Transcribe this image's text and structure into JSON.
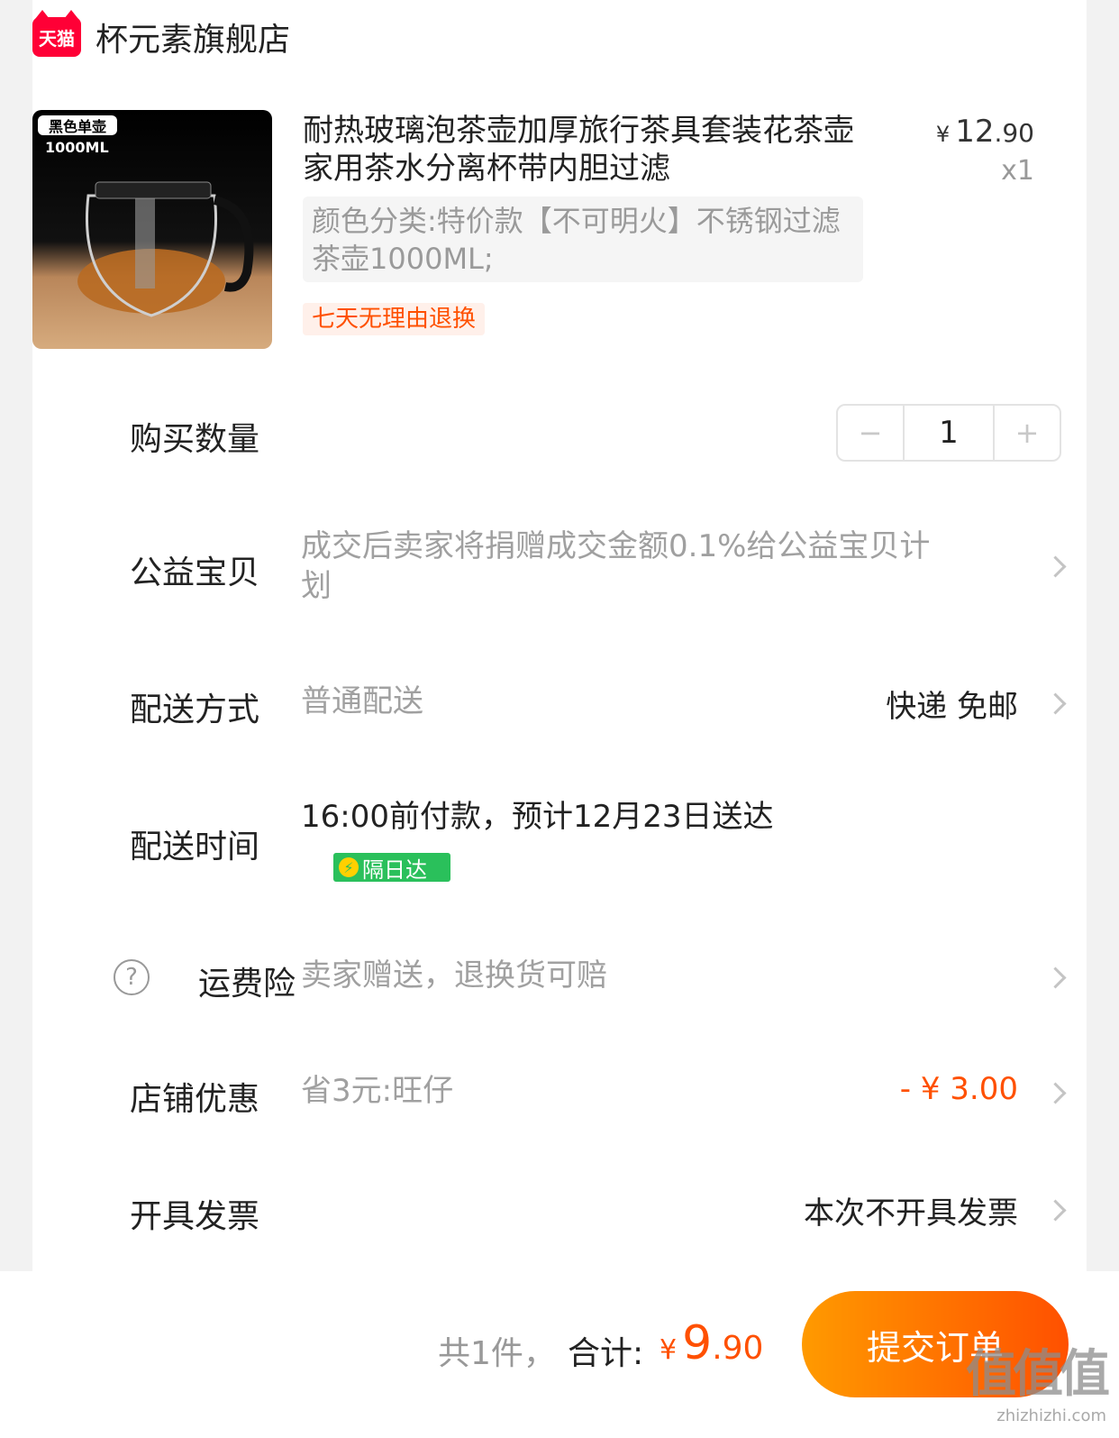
{
  "shop": {
    "logo_text": "天猫",
    "name": "杯元素旗舰店"
  },
  "product": {
    "image_badge": "黑色单壶",
    "image_size_text": "1000ML",
    "title": "耐热玻璃泡茶壶加厚旅行茶具套装花茶壶家用茶水分离杯带内胆过滤",
    "price_currency": "¥",
    "price_int": "12",
    "price_dec": ".90",
    "quantity_text": "x1",
    "sku_text": "颜色分类:特价款【不可明火】不锈钢过滤茶壶1000ML;",
    "return_tag": "七天无理由退换"
  },
  "quantity": {
    "label": "购买数量",
    "minus": "−",
    "value": "1",
    "plus": "+"
  },
  "charity": {
    "label": "公益宝贝",
    "value": "成交后卖家将捐赠成交金额0.1%给公益宝贝计划"
  },
  "delivery_method": {
    "label": "配送方式",
    "value": "普通配送",
    "right": "快递 免邮"
  },
  "delivery_time": {
    "label": "配送时间",
    "value": "16:00前付款，预计12月23日送达",
    "tag": "隔日达"
  },
  "shipping_insurance": {
    "label": "运费险",
    "value": "卖家赠送，退换货可赔"
  },
  "store_discount": {
    "label": "店铺优惠",
    "value": "省3元:旺仔",
    "amount": "- ¥ 3.00"
  },
  "invoice": {
    "label": "开具发票",
    "value": "本次不开具发票"
  },
  "footer": {
    "count_text": "共1件，",
    "total_label": "合计:",
    "total_currency": "¥",
    "total_int": "9",
    "total_dec": ".90",
    "submit": "提交订单"
  },
  "watermark": {
    "logo": "值值值",
    "url": "zhizhizhi.com"
  },
  "colors": {
    "accent": "#ff5000",
    "tmall_red": "#ff0036",
    "green_tag": "#2ac05b"
  }
}
